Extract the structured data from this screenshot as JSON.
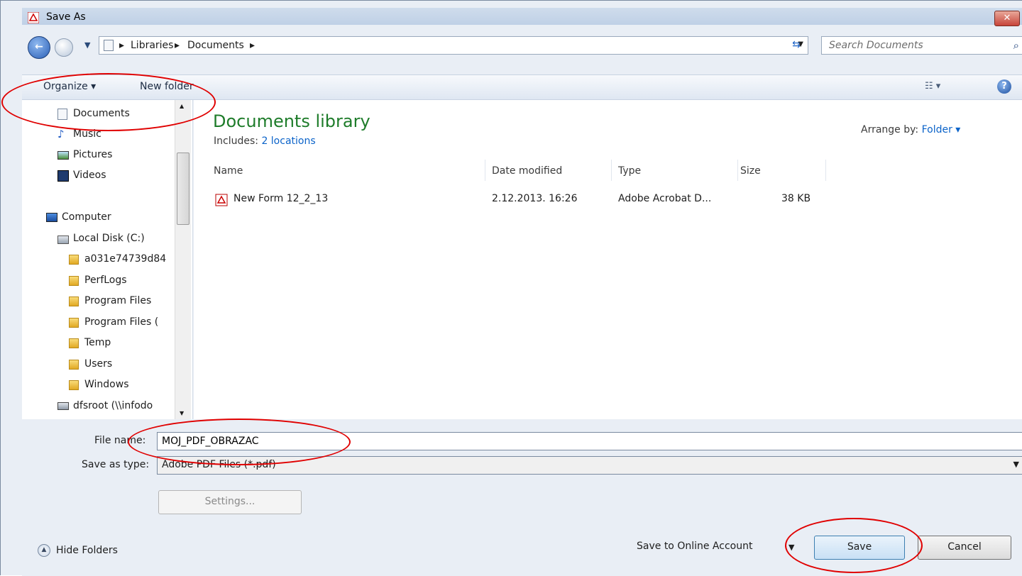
{
  "window": {
    "title": "Save As",
    "close_label": "✕"
  },
  "address": {
    "crumbs": [
      "Libraries",
      "Documents"
    ],
    "search_placeholder": "Search Documents"
  },
  "toolbar": {
    "organize_label": "Organize ▾",
    "new_folder_label": "New folder"
  },
  "nav": {
    "items": [
      {
        "label": "Documents",
        "icon": "documents-icon"
      },
      {
        "label": "Music",
        "icon": "music-icon"
      },
      {
        "label": "Pictures",
        "icon": "pictures-icon"
      },
      {
        "label": "Videos",
        "icon": "videos-icon"
      },
      {
        "label": "Computer",
        "icon": "computer-icon"
      },
      {
        "label": "Local Disk (C:)",
        "icon": "disk-icon"
      },
      {
        "label": "a031e74739d84",
        "icon": "folder-icon"
      },
      {
        "label": "PerfLogs",
        "icon": "folder-icon"
      },
      {
        "label": "Program Files",
        "icon": "folder-icon"
      },
      {
        "label": "Program Files (",
        "icon": "folder-icon"
      },
      {
        "label": "Temp",
        "icon": "folder-icon"
      },
      {
        "label": "Users",
        "icon": "folder-icon"
      },
      {
        "label": "Windows",
        "icon": "folder-icon"
      },
      {
        "label": "dfsroot (\\\\infodo",
        "icon": "network-drive-icon"
      }
    ]
  },
  "library": {
    "title": "Documents library",
    "includes_label": "Includes:",
    "includes_link": "2 locations",
    "arrange_label": "Arrange by:",
    "arrange_value": "Folder ▾"
  },
  "columns": [
    "Name",
    "Date modified",
    "Type",
    "Size"
  ],
  "files": [
    {
      "name": "New Form 12_2_13",
      "date": "2.12.2013. 16:26",
      "type": "Adobe Acrobat D...",
      "size": "38 KB"
    }
  ],
  "form": {
    "file_name_label": "File name:",
    "file_name_value": "MOJ_PDF_OBRAZAC",
    "save_type_label": "Save as type:",
    "save_type_value": "Adobe PDF Files (*.pdf)",
    "settings_label": "Settings...",
    "hide_folders_label": "Hide Folders",
    "online_label": "Save to Online Account",
    "save_label": "Save",
    "cancel_label": "Cancel"
  },
  "colors": {
    "annotation": "#e00000",
    "library_title": "#1e7c2a",
    "link": "#0b63c9"
  }
}
